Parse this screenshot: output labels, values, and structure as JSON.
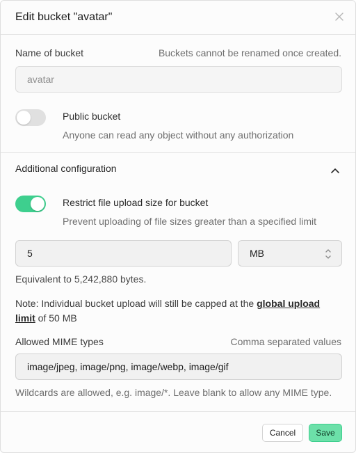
{
  "modal": {
    "title": "Edit bucket \"avatar\"",
    "close_icon": "close-icon"
  },
  "bucket_name": {
    "label": "Name of bucket",
    "hint": "Buckets cannot be renamed once created.",
    "value": "avatar"
  },
  "public_bucket": {
    "label": "Public bucket",
    "description": "Anyone can read any object without any authorization",
    "enabled": false
  },
  "additional_config": {
    "label": "Additional configuration",
    "expanded": true,
    "chevron_icon": "chevron-up-icon"
  },
  "restrict_size": {
    "label": "Restrict file upload size for bucket",
    "description": "Prevent uploading of file sizes greater than a specified limit",
    "enabled": true,
    "size_value": "5",
    "unit": "MB",
    "equivalent": "Equivalent to 5,242,880 bytes."
  },
  "note": {
    "prefix": "Note: Individual bucket upload will still be capped at the ",
    "link": "global upload limit",
    "suffix": " of 50 MB"
  },
  "mime": {
    "label": "Allowed MIME types",
    "hint": "Comma separated values",
    "value": "image/jpeg, image/png, image/webp, image/gif",
    "help": "Wildcards are allowed, e.g. image/*. Leave blank to allow any MIME type."
  },
  "footer": {
    "cancel_label": "Cancel",
    "save_label": "Save"
  },
  "colors": {
    "accent": "#3ecf8e",
    "save_bg": "#6ce0a9"
  }
}
